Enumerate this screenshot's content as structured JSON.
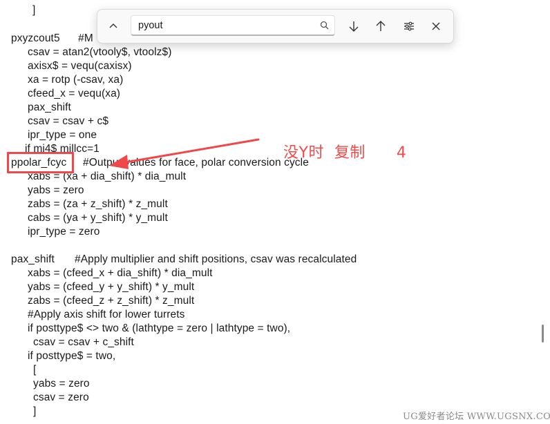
{
  "find_bar": {
    "query": "pyout",
    "collapse_icon": "chevron-up-icon",
    "search_icon": "search-icon",
    "next_icon": "arrow-down-icon",
    "prev_icon": "arrow-up-icon",
    "options_icon": "sliders-icon",
    "close_icon": "close-icon"
  },
  "code_lines": [
    "]",
    "pxyzcout5      #M",
    "csav = atan2(vtooly$, vtoolz$)",
    "axisx$ = vequ(caxisx)",
    "xa = rotp (-csav, xa)",
    "cfeed_x = vequ(xa)",
    "pax_shift",
    "csav = csav + c$",
    "ipr_type = one",
    "if mi4$ millcc=1",
    "ppolar_fcyc",
    "#Outpu  values for face, polar conversion cycle",
    "xabs = (xa + dia_shift) * dia_mult",
    "yabs = zero",
    "zabs = (za + z_shift) * z_mult",
    "cabs = (ya + y_shift) * y_mult",
    "ipr_type = zero",
    "pax_shift",
    "#Apply multiplier and shift positions, csav was recalculated",
    "xabs = (cfeed_x + dia_shift) * dia_mult",
    "yabs = (cfeed_y + y_shift) * y_mult",
    "zabs = (cfeed_z + z_shift) * z_mult",
    "#Apply axis shift for lower turrets",
    "if posttype$ <> two & (lathtype = zero | lathtype = two),",
    "csav = csav + c_shift",
    "if posttype$ = two,",
    "[",
    "yabs = zero",
    "csav = zero",
    "]"
  ],
  "annotation": {
    "text": "没Y时  复制      4",
    "color": "#ef4b4b"
  },
  "watermark": "UG爱好者论坛 WWW.UGSNX.COM"
}
